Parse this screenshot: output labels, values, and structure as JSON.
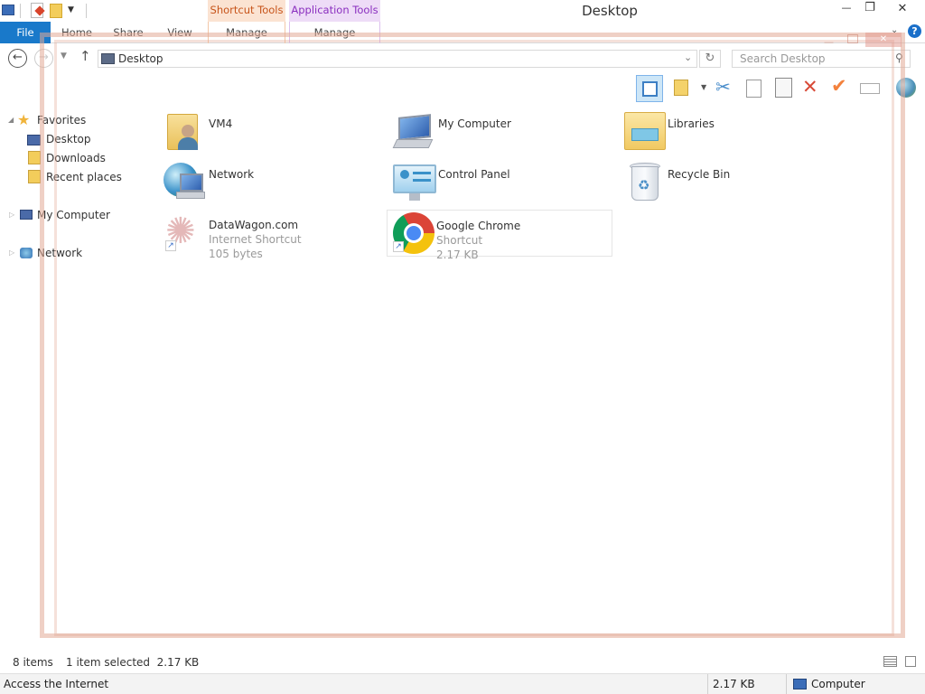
{
  "window": {
    "title": "Desktop",
    "minimize": "—",
    "maximize": "❐",
    "close": "✕"
  },
  "ribbon": {
    "file": "File",
    "tabs": [
      "Home",
      "Share",
      "View"
    ],
    "contextual": [
      {
        "group": "Shortcut Tools",
        "tab": "Manage",
        "color": "#fbe3d2",
        "text_color": "#c7541a"
      },
      {
        "group": "Application Tools",
        "tab": "Manage",
        "color": "#eedcf7",
        "text_color": "#8a2fbf"
      }
    ],
    "accent": "#1979ca"
  },
  "address": {
    "path": "Desktop",
    "search_placeholder": "Search Desktop"
  },
  "nav": {
    "favorites": "Favorites",
    "fav_items": [
      "Desktop",
      "Downloads",
      "Recent places"
    ],
    "computer": "My Computer",
    "network": "Network"
  },
  "items": [
    {
      "name": "VM4",
      "line2": "",
      "line3": "",
      "icon": "user-folder-icon"
    },
    {
      "name": "My Computer",
      "line2": "",
      "line3": "",
      "icon": "computer-icon"
    },
    {
      "name": "Libraries",
      "line2": "",
      "line3": "",
      "icon": "libraries-folder-icon"
    },
    {
      "name": "Network",
      "line2": "",
      "line3": "",
      "icon": "network-globe-icon"
    },
    {
      "name": "Control Panel",
      "line2": "",
      "line3": "",
      "icon": "control-panel-icon"
    },
    {
      "name": "Recycle Bin",
      "line2": "",
      "line3": "",
      "icon": "recycle-bin-icon"
    },
    {
      "name": "DataWagon.com",
      "line2": "Internet Shortcut",
      "line3": "105 bytes",
      "icon": "internet-shortcut-icon"
    },
    {
      "name": "Google Chrome",
      "line2": "Shortcut",
      "line3": "2.17 KB",
      "icon": "chrome-icon",
      "selected": true
    }
  ],
  "status": {
    "count": "8 items",
    "selection": "1 item selected  2.17 KB"
  },
  "bottom": {
    "hint": "Access the Internet",
    "size": "2.17 KB",
    "zone": "Computer"
  }
}
